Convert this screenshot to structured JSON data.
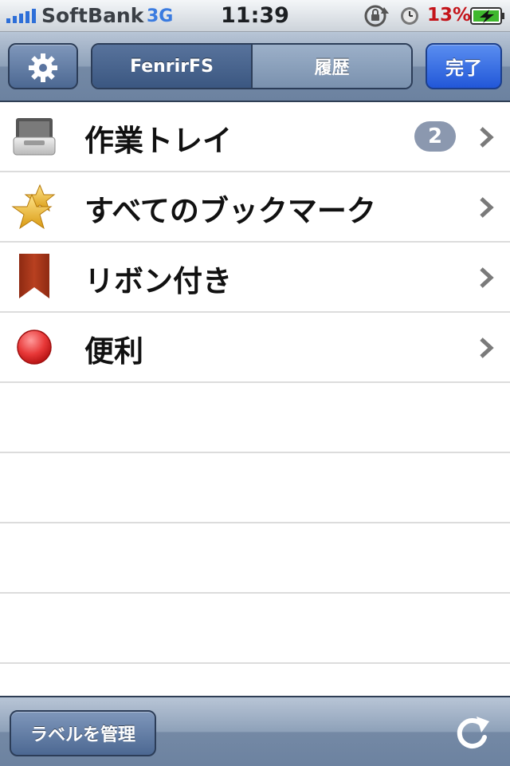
{
  "status_bar": {
    "carrier": "SoftBank",
    "network": "3G",
    "time": "11:39",
    "battery": "13%",
    "icons": [
      "signal-bars-icon",
      "rotation-lock-icon",
      "alarm-icon",
      "battery-charging-icon"
    ]
  },
  "navbar": {
    "settings_icon": "gear-icon",
    "segments": [
      {
        "label": "FenrirFS",
        "selected": true
      },
      {
        "label": "履歴",
        "selected": false
      }
    ],
    "done_label": "完了",
    "accent_color": "#2257d8"
  },
  "list": {
    "items": [
      {
        "label": "作業トレイ",
        "icon": "tray-icon",
        "badge": "2"
      },
      {
        "label": "すべてのブックマーク",
        "icon": "star-icon"
      },
      {
        "label": "リボン付き",
        "icon": "ribbon-icon"
      },
      {
        "label": "便利",
        "icon": "red-dot-icon"
      }
    ]
  },
  "toolbar": {
    "manage_label": "ラベルを管理",
    "refresh_icon": "refresh-icon"
  }
}
